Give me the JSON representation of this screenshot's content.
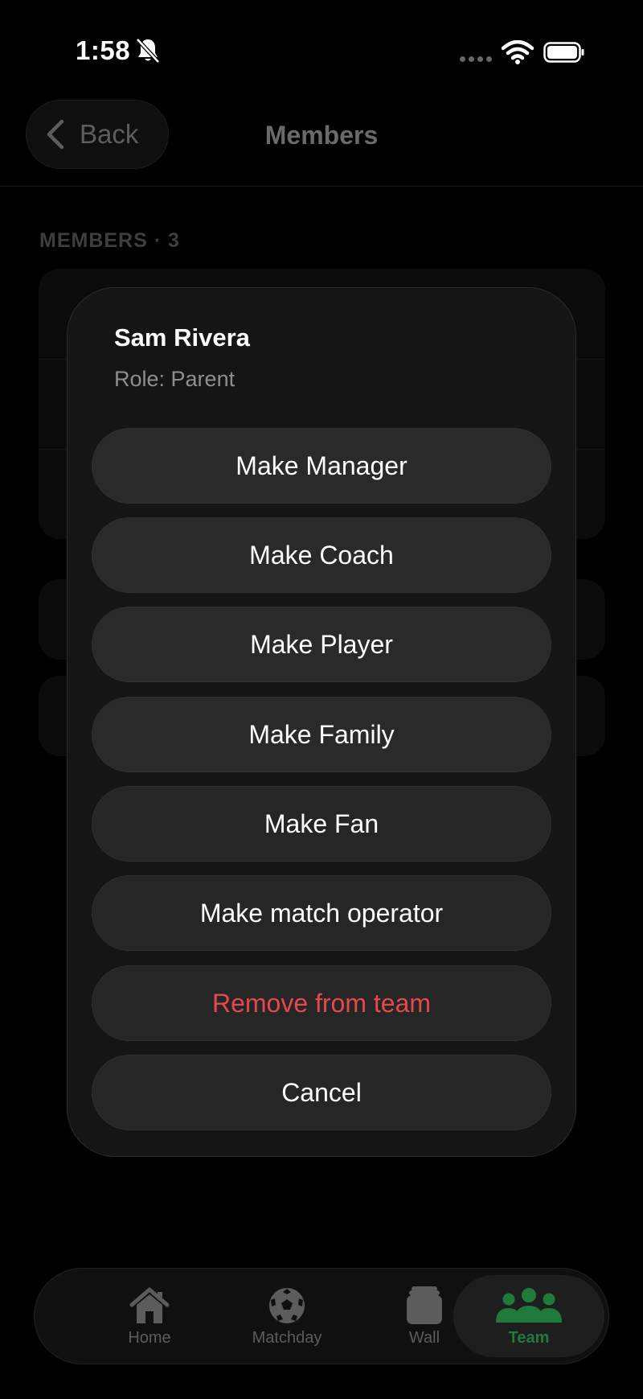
{
  "status_bar": {
    "time": "1:58",
    "icons": [
      "bell-slash-icon",
      "signal-dots-icon",
      "wifi-icon",
      "battery-icon"
    ]
  },
  "header": {
    "back_label": "Back",
    "title": "Members"
  },
  "members_section": {
    "label": "MEMBERS · 3"
  },
  "action_sheet": {
    "name": "Sam Rivera",
    "role": "Role: Parent",
    "actions": [
      {
        "label": "Make Manager",
        "style": "default"
      },
      {
        "label": "Make Coach",
        "style": "default"
      },
      {
        "label": "Make Player",
        "style": "default"
      },
      {
        "label": "Make Family",
        "style": "default"
      },
      {
        "label": "Make Fan",
        "style": "default"
      },
      {
        "label": "Make match operator",
        "style": "default"
      },
      {
        "label": "Remove from team",
        "style": "destructive"
      },
      {
        "label": "Cancel",
        "style": "cancel"
      }
    ]
  },
  "tab_bar": {
    "tabs": [
      {
        "label": "Home",
        "icon": "house-icon",
        "active": false
      },
      {
        "label": "Matchday",
        "icon": "soccer-ball-icon",
        "active": false
      },
      {
        "label": "Wall",
        "icon": "stack-icon",
        "active": false
      },
      {
        "label": "Team",
        "icon": "people-icon",
        "active": true
      }
    ]
  },
  "colors": {
    "background": "#000000",
    "sheet": "#151515",
    "button": "#262626",
    "destructive": "#e5484d",
    "accent_green": "#1f7a3c"
  }
}
